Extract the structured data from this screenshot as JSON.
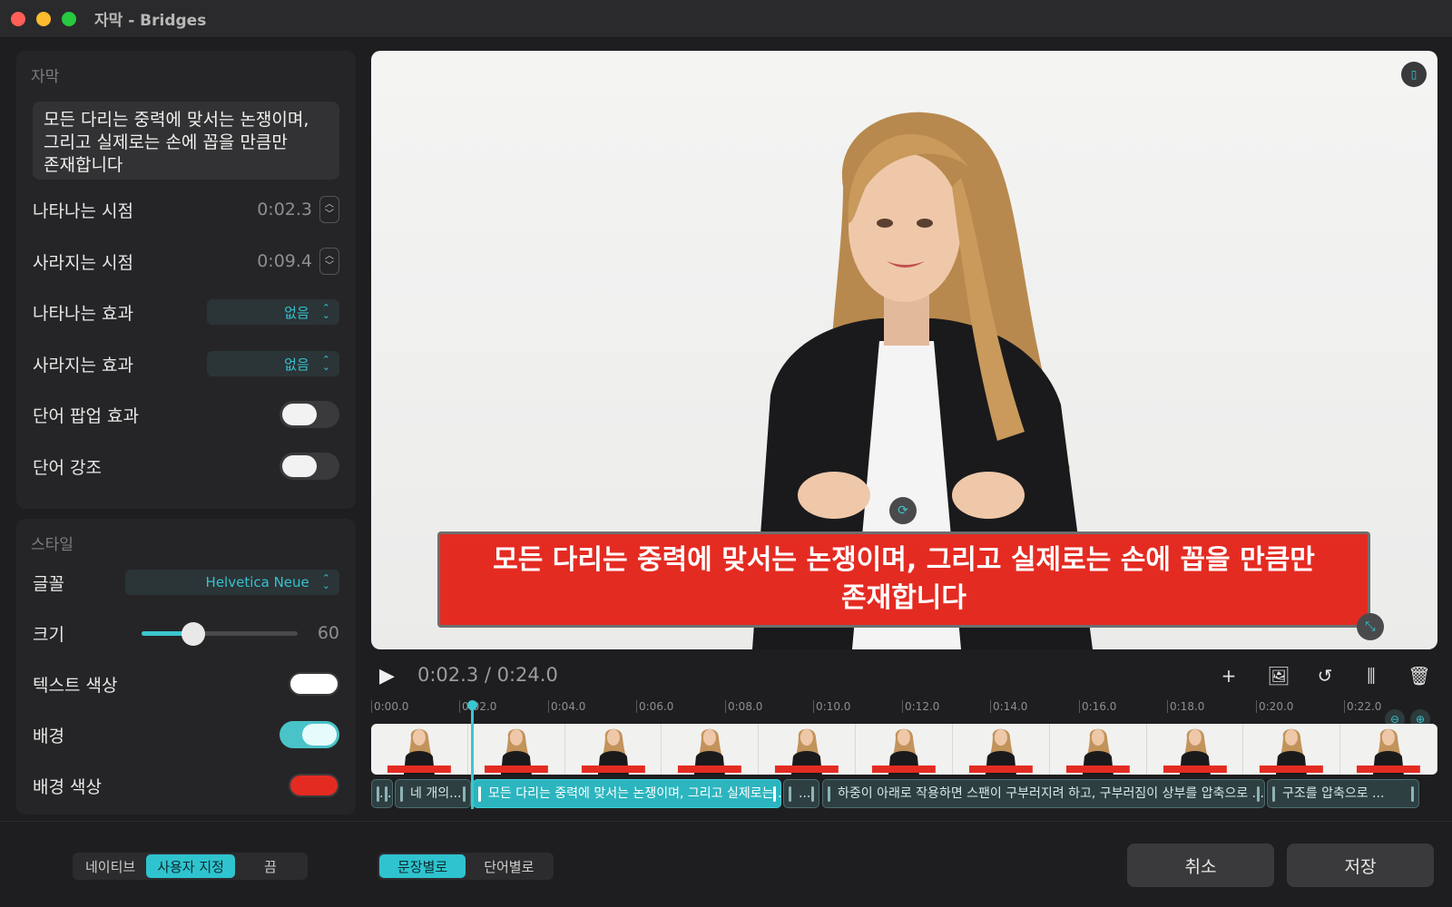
{
  "window": {
    "title": "자막 - Bridges"
  },
  "subtitle_panel": {
    "title": "자막",
    "text": "모든 다리는 중력에 맞서는 논쟁이며,\n그리고 실제로는 손에 꼽을 만큼만\n존재합니다",
    "appear_time": {
      "label": "나타나는 시점",
      "value": "0:02.3"
    },
    "disappear_time": {
      "label": "사라지는 시점",
      "value": "0:09.4"
    },
    "appear_effect": {
      "label": "나타나는 효과",
      "value": "없음"
    },
    "disappear_effect": {
      "label": "사라지는 효과",
      "value": "없음"
    },
    "word_popup": {
      "label": "단어 팝업 효과",
      "on": false
    },
    "word_highlight": {
      "label": "단어 강조",
      "on": false
    }
  },
  "style_panel": {
    "title": "스타일",
    "font": {
      "label": "글꼴",
      "value": "Helvetica Neue"
    },
    "size": {
      "label": "크기",
      "value": "60",
      "fraction": 0.33
    },
    "text_color": {
      "label": "텍스트 색상",
      "color": "#ffffff"
    },
    "background": {
      "label": "배경",
      "on": true
    },
    "background_color": {
      "label": "배경 색상",
      "color": "#e42b22"
    }
  },
  "preview": {
    "caption": "모든 다리는 중력에 맞서는 논쟁이며, 그리고 실제로는 손에 꼽을 만큼만\n존재합니다"
  },
  "playback": {
    "time": "0:02.3 / 0:24.0"
  },
  "timeline": {
    "ticks": [
      "0:00.0",
      "0:02.0",
      "0:04.0",
      "0:06.0",
      "0:08.0",
      "0:10.0",
      "0:12.0",
      "0:14.0",
      "0:16.0",
      "0:18.0",
      "0:20.0",
      "0:22.0"
    ],
    "clips": [
      {
        "text": "..."
      },
      {
        "text": "네 개의..."
      },
      {
        "text": "모든 다리는 중력에 맞서는 논쟁이며, 그리고 실제로는 ..."
      },
      {
        "text": "..."
      },
      {
        "text": "하중이 아래로 작용하면 스팬이 구부러지려 하고, 구부러짐이 상부를 압축으로 ..."
      },
      {
        "text": "구조를 압축으로 ..."
      }
    ]
  },
  "bottom": {
    "mode": [
      "네이티브",
      "사용자 지정",
      "끔"
    ],
    "split": [
      "문장별로",
      "단어별로"
    ],
    "cancel": "취소",
    "save": "저장"
  },
  "colors": {
    "accent": "#3bc6cf",
    "caption_bg": "#e42b22"
  },
  "icons": [
    "play-icon",
    "plus-icon",
    "image-add-icon",
    "rotate-icon",
    "waveform-icon",
    "trash-icon",
    "zoom-in-icon",
    "zoom-out-icon"
  ]
}
